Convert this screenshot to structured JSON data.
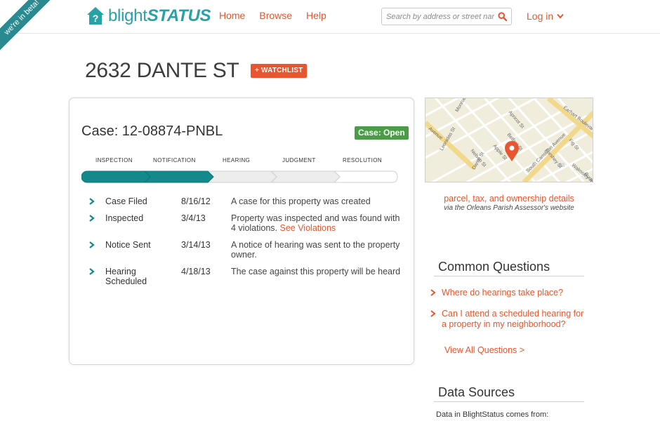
{
  "header": {
    "beta_ribbon": "we're in beta!",
    "logo_prefix": "blight",
    "logo_suffix": "STATUS",
    "nav": [
      "Home",
      "Browse",
      "Help"
    ],
    "search_placeholder": "Search by address or street name",
    "login_label": "Log in"
  },
  "page": {
    "address": "2632 DANTE ST",
    "watchlist_label": "+ WATCHLIST"
  },
  "case": {
    "title": "Case: 12-08874-PNBL",
    "status": "Case: Open",
    "stages": [
      "INSPECTION",
      "NOTIFICATION",
      "HEARING",
      "JUDGMENT",
      "RESOLUTION"
    ],
    "completed_stages": 2,
    "events": [
      {
        "name": "Case Filed",
        "date": "8/16/12",
        "description": "A case for this property was created",
        "link": ""
      },
      {
        "name": "Inspected",
        "date": "3/4/13",
        "description": "Property was inspected and was found with 4 violations. ",
        "link": "See Violations"
      },
      {
        "name": "Notice Sent",
        "date": "3/14/13",
        "description": "A notice of hearing was sent to the property owner.",
        "link": ""
      },
      {
        "name": "Hearing Scheduled",
        "date": "4/18/13",
        "description": "The case against this property will be heard",
        "link": ""
      }
    ]
  },
  "sidebar": {
    "map_streets": [
      "Monroe St",
      "Leonidas St",
      "Nelson St",
      "Apple St",
      "Belfast St",
      "Dante St",
      "Fig St",
      "Earhart Boulevard",
      "South Carrollton Avenue",
      "Walmsley Ave",
      "Apricot St",
      "Forshey St",
      "Burdette St",
      "Avenue"
    ],
    "assessor_link": "parcel, tax, and ownership details",
    "assessor_sub": "via the Orleans Parish Assessor's website",
    "common_questions_title": "Common Questions",
    "questions": [
      "Where do hearings take place?",
      "Can I attend a scheduled hearing for a property in my neighborhood?"
    ],
    "view_all": "View All Questions >",
    "data_sources_title": "Data Sources",
    "data_sources_text": "Data in BlightStatus comes from:"
  },
  "colors": {
    "accent": "#e8552e",
    "teal": "#27a3a8",
    "progress_done": "#13898c",
    "status_green": "#4a9d46"
  },
  "icons": {
    "logo": "house-question-icon",
    "search": "search-icon",
    "login": "chevron-down-icon",
    "event_bullet": "chevron-right-icon",
    "map_pin": "map-pin-icon"
  }
}
